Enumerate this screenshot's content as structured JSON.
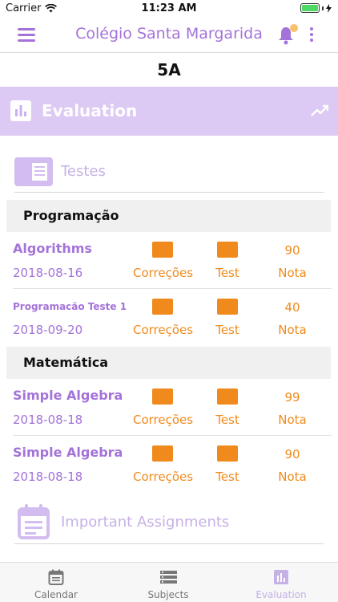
{
  "status_bar": {
    "carrier": "Carrier",
    "time": "11:23 AM"
  },
  "nav": {
    "title": "Colégio Santa Margarida"
  },
  "class_name": "5A",
  "section": {
    "title": "Evaluation"
  },
  "tests_section": {
    "label": "Testes"
  },
  "subjects": [
    {
      "name": "Programação",
      "tests": [
        {
          "name": "Algorithms",
          "date": "2018-08-16",
          "corrections_label": "Correções",
          "test_label": "Test",
          "grade": "90",
          "grade_label": "Nota"
        },
        {
          "name": "Programacão Teste 1",
          "date": "2018-09-20",
          "corrections_label": "Correções",
          "test_label": "Test",
          "grade": "40",
          "grade_label": "Nota"
        }
      ]
    },
    {
      "name": "Matemática",
      "tests": [
        {
          "name": "Simple Algebra",
          "date": "2018-08-18",
          "corrections_label": "Correções",
          "test_label": "Test",
          "grade": "99",
          "grade_label": "Nota"
        },
        {
          "name": "Simple Algebra",
          "date": "2018-08-18",
          "corrections_label": "Correções",
          "test_label": "Test",
          "grade": "90",
          "grade_label": "Nota"
        }
      ]
    }
  ],
  "important_section": {
    "label": "Important Assignments"
  },
  "tabs": [
    {
      "label": "Calendar",
      "icon": "calendar-icon",
      "active": false
    },
    {
      "label": "Subjects",
      "icon": "list-icon",
      "active": false
    },
    {
      "label": "Evaluation",
      "icon": "bar-chart-icon",
      "active": true
    }
  ],
  "colors": {
    "accent": "#a473d9",
    "header_bg": "#dcc9f4",
    "orange": "#f08a1c",
    "muted_purple": "#c6b1e6"
  }
}
